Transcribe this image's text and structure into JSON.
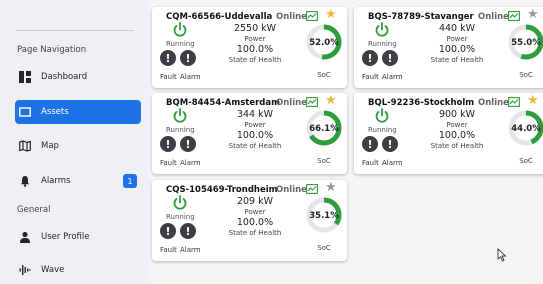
{
  "sidebar": {
    "sections": [
      "Page Navigation",
      "General"
    ],
    "items": [
      {
        "label": "Dashboard",
        "icon": "dashboard-icon",
        "active": false
      },
      {
        "label": "Assets",
        "icon": "assets-icon",
        "active": true
      },
      {
        "label": "Map",
        "icon": "map-icon",
        "active": false
      },
      {
        "label": "Alarms",
        "icon": "bell-icon",
        "active": false,
        "badge": "1"
      },
      {
        "label": "User Profile",
        "icon": "user-icon",
        "active": false
      },
      {
        "label": "Wave",
        "icon": "wave-icon",
        "active": false
      }
    ]
  },
  "assets": [
    {
      "name": "CQM-66566-Uddevalla",
      "status": "Online",
      "favorite": true,
      "state": "Running",
      "power": "2550 kW",
      "power_label": "Power",
      "soh": "100.0%",
      "soh_label": "State of Health",
      "soc": 52.0,
      "soc_text": "52.0%",
      "soc_label": "SoC",
      "fault_label": "Fault",
      "alarm_label": "Alarm"
    },
    {
      "name": "BQS-78789-Stavanger",
      "status": "Online",
      "favorite": false,
      "state": "Running",
      "power": "440 kW",
      "power_label": "Power",
      "soh": "100.0%",
      "soh_label": "State of Health",
      "soc": 55.0,
      "soc_text": "55.0%",
      "soc_label": "SoC",
      "fault_label": "Fault",
      "alarm_label": "Alarm"
    },
    {
      "name": "BQM-84454-Amsterdam",
      "status": "Online",
      "favorite": true,
      "state": "Running",
      "power": "344 kW",
      "power_label": "Power",
      "soh": "100.0%",
      "soh_label": "State of Health",
      "soc": 66.1,
      "soc_text": "66.1%",
      "soc_label": "SoC",
      "fault_label": "Fault",
      "alarm_label": "Alarm"
    },
    {
      "name": "BQL-92236-Stockholm",
      "status": "Online",
      "favorite": true,
      "state": "Running",
      "power": "900 kW",
      "power_label": "Power",
      "soh": "100.0%",
      "soh_label": "State of Health",
      "soc": 44.0,
      "soc_text": "44.0%",
      "soc_label": "SoC",
      "fault_label": "Fault",
      "alarm_label": "Alarm"
    },
    {
      "name": "CQS-105469-Trondheim",
      "status": "Online",
      "favorite": false,
      "state": "Running",
      "power": "209 kW",
      "power_label": "Power",
      "soh": "100.0%",
      "soh_label": "State of Health",
      "soc": 35.1,
      "soc_text": "35.1%",
      "soc_label": "SoC",
      "fault_label": "Fault",
      "alarm_label": "Alarm"
    }
  ],
  "colors": {
    "accent": "#1d72e8",
    "running": "#2e9e3c",
    "gauge": "#2e9e3c",
    "gauge_track": "#e3e5e8",
    "star_on": "#f2b53a",
    "star_off": "#9a9a9a"
  }
}
